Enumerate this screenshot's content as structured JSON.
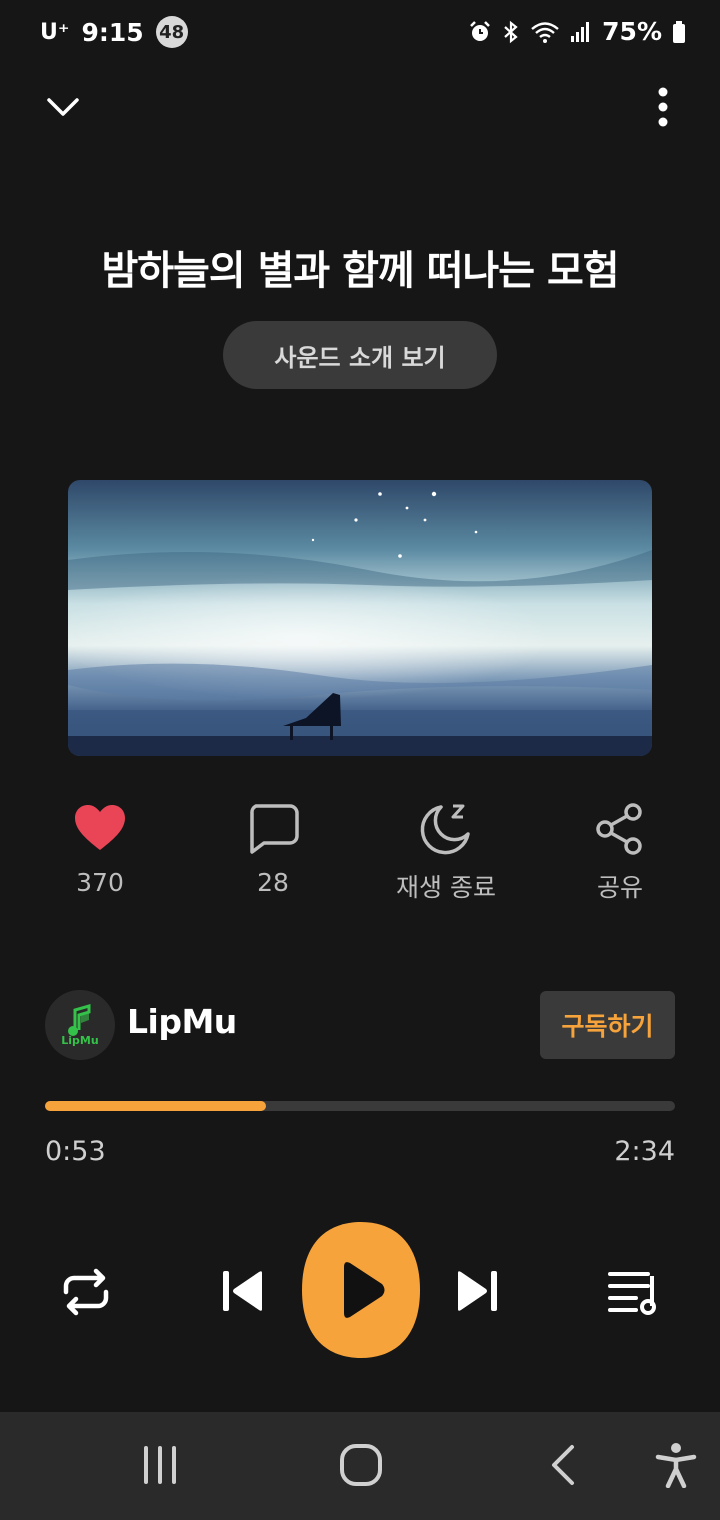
{
  "status_bar": {
    "carrier": "U⁺",
    "time": "9:15",
    "badge": "48",
    "battery": "75%"
  },
  "player": {
    "title": "밤하늘의 별과 함께 떠나는 모험",
    "intro_button": "사운드 소개 보기",
    "actions": {
      "like_count": "370",
      "comment_count": "28",
      "sleep_label": "재생 종료",
      "share_label": "공유"
    },
    "channel": {
      "avatar_text": "LipMu",
      "name": "LipMu",
      "subscribe_label": "구독하기"
    },
    "progress": {
      "current": "0:53",
      "total": "2:34",
      "fraction": 0.35
    }
  },
  "colors": {
    "accent": "#f6a33b",
    "like": "#e94557",
    "background": "#161616"
  },
  "icons": [
    "chevron-down-icon",
    "more-vert-icon",
    "heart-icon",
    "comment-icon",
    "sleep-timer-icon",
    "share-icon",
    "repeat-icon",
    "skip-previous-icon",
    "play-icon",
    "skip-next-icon",
    "playlist-icon",
    "recents-icon",
    "home-icon",
    "back-icon",
    "accessibility-icon"
  ]
}
